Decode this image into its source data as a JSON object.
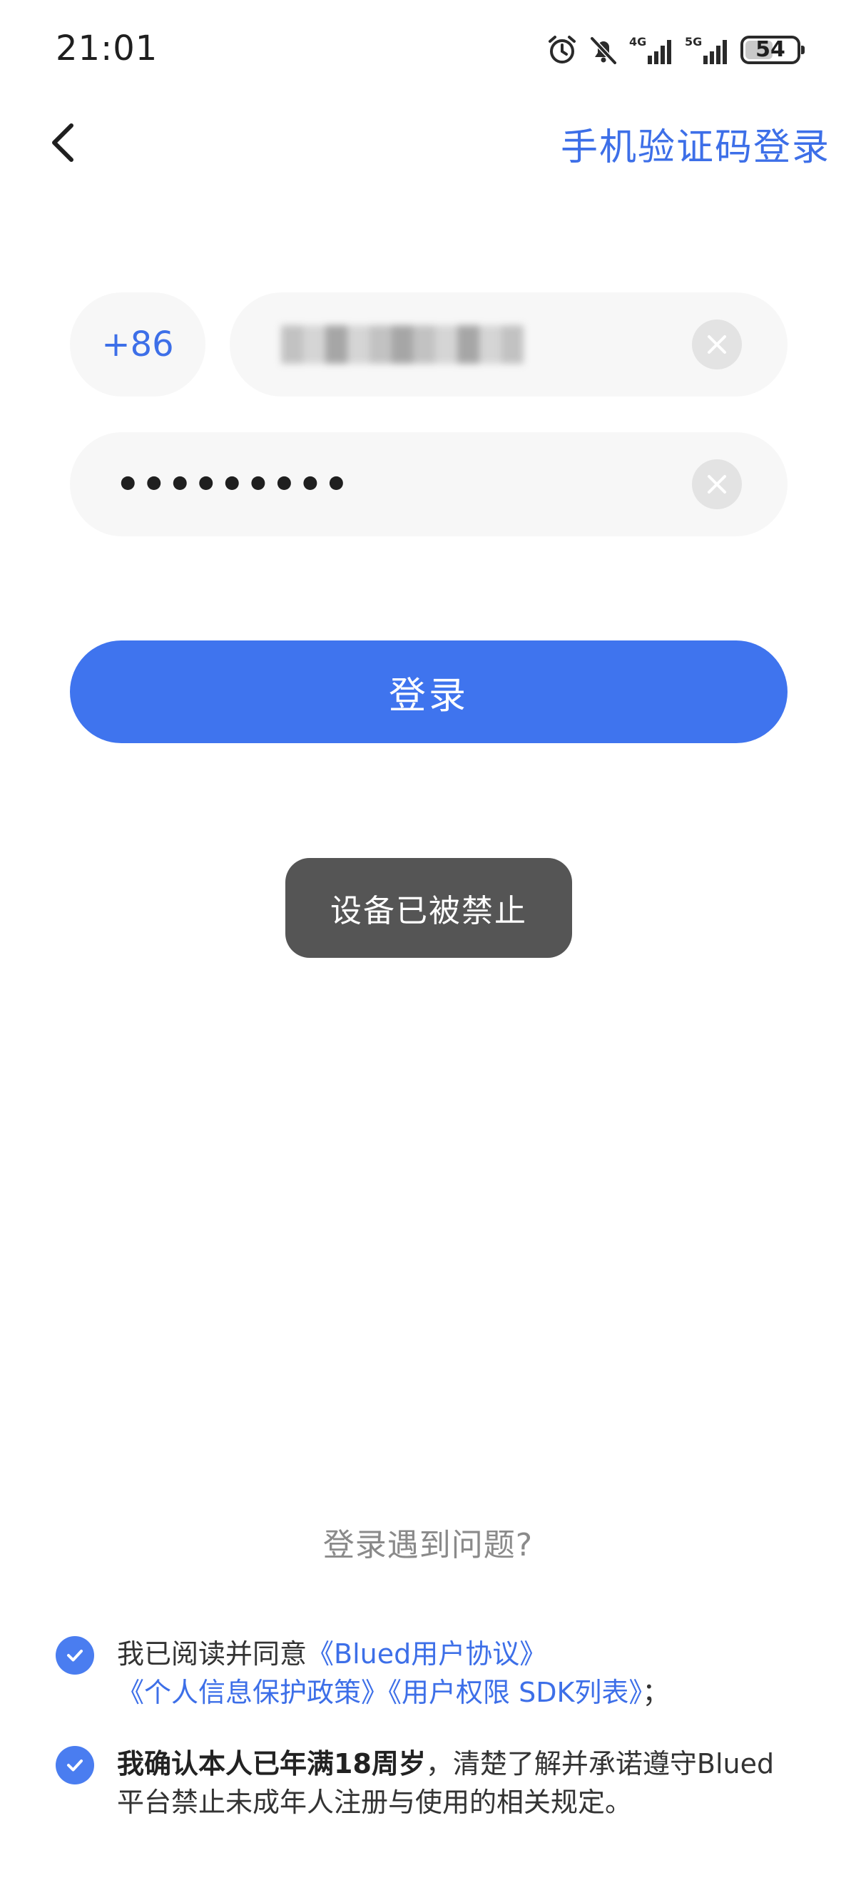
{
  "status_bar": {
    "time": "21:01",
    "signal_1_label": "4G",
    "signal_2_label": "5G",
    "battery_level": "54",
    "icons": [
      "alarm-icon",
      "mute-bell-icon",
      "signal-4g-icon",
      "signal-5g-icon",
      "battery-icon"
    ]
  },
  "nav": {
    "back_icon": "chevron-left-icon",
    "sms_login_label": "手机验证码登录"
  },
  "form": {
    "country_code": "+86",
    "phone_value_redacted": true,
    "password_value": "•••••••••",
    "clear_icon": "close-icon"
  },
  "login_button": {
    "label": "登录"
  },
  "toast": {
    "message": "设备已被禁止"
  },
  "help": {
    "label": "登录遇到问题?"
  },
  "agreements": {
    "item1": {
      "prefix": "我已阅读并同意",
      "link_user_agreement": "《Blued用户协议》",
      "link_privacy_policy": "《个人信息保护政策》",
      "link_sdk_list": "《用户权限 SDK列表》",
      "suffix": "；"
    },
    "item2": {
      "bold": "我确认本人已年满18周岁",
      "rest": "，清楚了解并承诺遵守Blued平台禁止未成年人注册与使用的相关规定。"
    }
  },
  "colors": {
    "accent": "#3f74ee",
    "link": "#3d6fe8",
    "field_bg": "#f7f7f7",
    "toast_bg": "#555555"
  }
}
